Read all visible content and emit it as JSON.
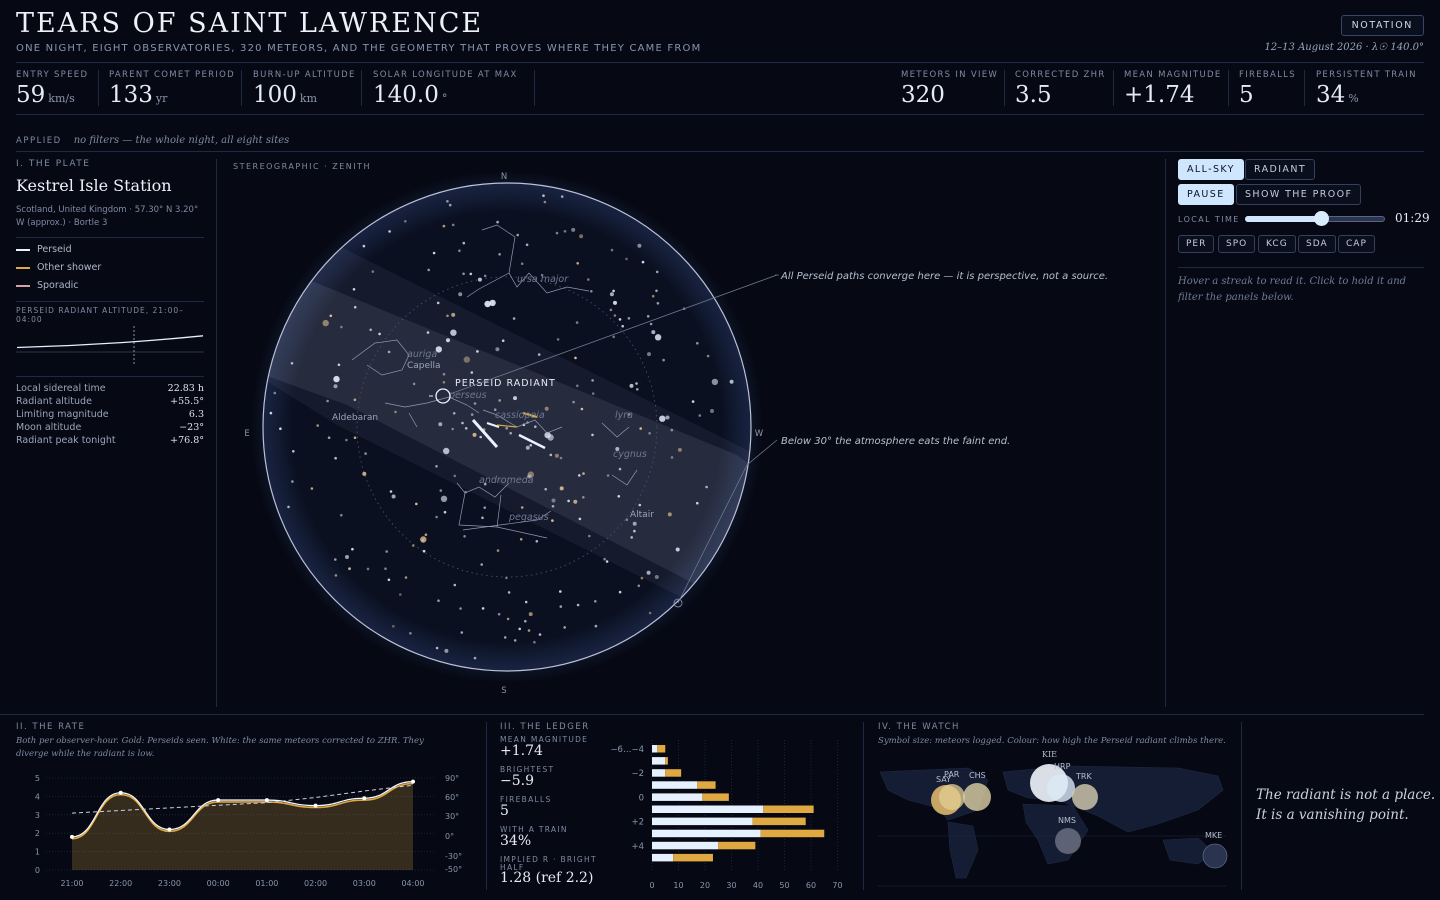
{
  "header": {
    "title": "TEARS OF SAINT LAWRENCE",
    "subtitle": "ONE NIGHT, EIGHT OBSERVATORIES, 320 METEORS, AND THE GEOMETRY THAT PROVES WHERE THEY CAME FROM",
    "notation_label": "NOTATION",
    "date_line": "12–13 August 2026 · λ☉ 140.0°"
  },
  "stats_left": [
    {
      "label": "ENTRY SPEED",
      "value": "59",
      "unit": "km/s"
    },
    {
      "label": "PARENT COMET PERIOD",
      "value": "133",
      "unit": "yr"
    },
    {
      "label": "BURN-UP ALTITUDE",
      "value": "100",
      "unit": "km"
    },
    {
      "label": "SOLAR LONGITUDE AT MAX",
      "value": "140.0",
      "unit": "°"
    }
  ],
  "stats_right": [
    {
      "label": "METEORS IN VIEW",
      "value": "320",
      "unit": ""
    },
    {
      "label": "CORRECTED ZHR",
      "value": "3.5",
      "unit": ""
    },
    {
      "label": "MEAN MAGNITUDE",
      "value": "+1.74",
      "unit": ""
    },
    {
      "label": "FIREBALLS",
      "value": "5",
      "unit": ""
    },
    {
      "label": "PERSISTENT TRAIN",
      "value": "34",
      "unit": "%"
    }
  ],
  "applied": {
    "label": "APPLIED",
    "value": "no filters — the whole night, all eight sites"
  },
  "plate": {
    "section": "I. THE PLATE",
    "station": "Kestrel Isle Station",
    "location": "Scotland, United Kingdom · 57.30° N 3.20° W (approx.) · Bortle 3",
    "legend": [
      {
        "label": "Perseid",
        "color": "#e9f2ff"
      },
      {
        "label": "Other shower",
        "color": "#e0a840"
      },
      {
        "label": "Sporadic",
        "color": "#d9a0a0"
      }
    ],
    "altitude_title": "PERSEID RADIANT ALTITUDE, 21:00–04:00",
    "facts": [
      {
        "k": "Local sidereal time",
        "v": "22.83 h"
      },
      {
        "k": "Radiant altitude",
        "v": "+55.5°"
      },
      {
        "k": "Limiting magnitude",
        "v": "6.3"
      },
      {
        "k": "Moon altitude",
        "v": "−23°"
      },
      {
        "k": "Radiant peak tonight",
        "v": "+76.8°"
      }
    ]
  },
  "sky": {
    "projection": "STEREOGRAPHIC · ZENITH",
    "compass": {
      "n": "N",
      "s": "S",
      "e": "E",
      "w": "W"
    },
    "radiant_label": "PERSEID RADIANT",
    "annotation_converge": "All Perseid paths converge here — it is perspective, not a source.",
    "annotation_horizon": "Below 30° the atmosphere eats the faint end.",
    "constellations": [
      "ursa major",
      "auriga",
      "perseus",
      "cassiopeia",
      "lyra",
      "cygnus",
      "andromeda",
      "pegasus"
    ],
    "stars": [
      "Capella",
      "Aldebaran",
      "Altair"
    ]
  },
  "controls": {
    "view_modes": [
      "ALL-SKY",
      "RADIANT"
    ],
    "pause": "PAUSE",
    "proof": "SHOW THE PROOF",
    "time_label": "LOCAL TIME",
    "time_value": "01:29",
    "time_progress": 0.55,
    "showers": [
      "PER",
      "SPO",
      "KCG",
      "SDA",
      "CAP"
    ],
    "hint": "Hover a streak to read it. Click to hold it and filter the panels below."
  },
  "rate": {
    "section": "II. THE RATE",
    "note": "Both per observer-hour. Gold: Perseids seen. White: the same meteors corrected to ZHR. They diverge while the radiant is low."
  },
  "ledger": {
    "section": "III. THE LEDGER",
    "items": [
      {
        "label": "MEAN MAGNITUDE",
        "value": "+1.74"
      },
      {
        "label": "BRIGHTEST",
        "value": "−5.9"
      },
      {
        "label": "FIREBALLS",
        "value": "5"
      },
      {
        "label": "WITH A TRAIN",
        "value": "34%"
      },
      {
        "label": "IMPLIED R · BRIGHT HALF",
        "value": "1.28 (ref 2.2)"
      }
    ]
  },
  "watch": {
    "section": "IV. THE WATCH",
    "note": "Symbol size: meteors logged. Colour: how high the Perseid radiant climbs there.",
    "sites": [
      "SAY",
      "PAR",
      "CHS",
      "KIE",
      "HRP",
      "TRK",
      "NMS",
      "MKE"
    ]
  },
  "closing": {
    "line1": "The radiant is not a place.",
    "line2": "It is a vanishing point."
  },
  "chart_data": [
    {
      "type": "line",
      "title": "II. THE RATE",
      "x": [
        "21:00",
        "22:00",
        "23:00",
        "00:00",
        "01:00",
        "02:00",
        "03:00",
        "04:00"
      ],
      "series": [
        {
          "name": "Perseids seen",
          "values": [
            1.7,
            4.1,
            2.1,
            3.7,
            3.7,
            3.4,
            3.8,
            4.7
          ]
        },
        {
          "name": "ZHR",
          "values": [
            1.8,
            4.2,
            2.2,
            3.8,
            3.8,
            3.5,
            3.9,
            4.8
          ]
        },
        {
          "name": "Radiant altitude",
          "values": [
            36,
            40,
            44,
            48,
            52,
            60,
            70,
            79
          ]
        }
      ],
      "ylim": [
        0,
        5
      ],
      "yticks": [
        "0",
        "1",
        "2",
        "3",
        "4",
        "5"
      ],
      "y2ticks": [
        "90°",
        "60°",
        "30°",
        "0°",
        "-30°",
        "-50°"
      ]
    },
    {
      "type": "bar",
      "title": "III. THE LEDGER",
      "categories": [
        "−6…−4",
        "",
        "−2",
        "",
        "0",
        "",
        "+2",
        "",
        "+4",
        ""
      ],
      "series": [
        {
          "name": "Perseid",
          "values": [
            2,
            5,
            5,
            17,
            19,
            42,
            38,
            41,
            25,
            8
          ]
        },
        {
          "name": "Other",
          "values": [
            3,
            1,
            6,
            7,
            10,
            19,
            20,
            24,
            14,
            15
          ]
        }
      ],
      "xticks": [
        "0",
        "10",
        "20",
        "30",
        "40",
        "50",
        "60",
        "70"
      ],
      "xlim": [
        0,
        70
      ]
    },
    {
      "type": "altitude",
      "title": "PERSEID RADIANT ALTITUDE, 21:00–04:00",
      "values": [
        30,
        34,
        38,
        44,
        50,
        58,
        67,
        77
      ]
    }
  ]
}
